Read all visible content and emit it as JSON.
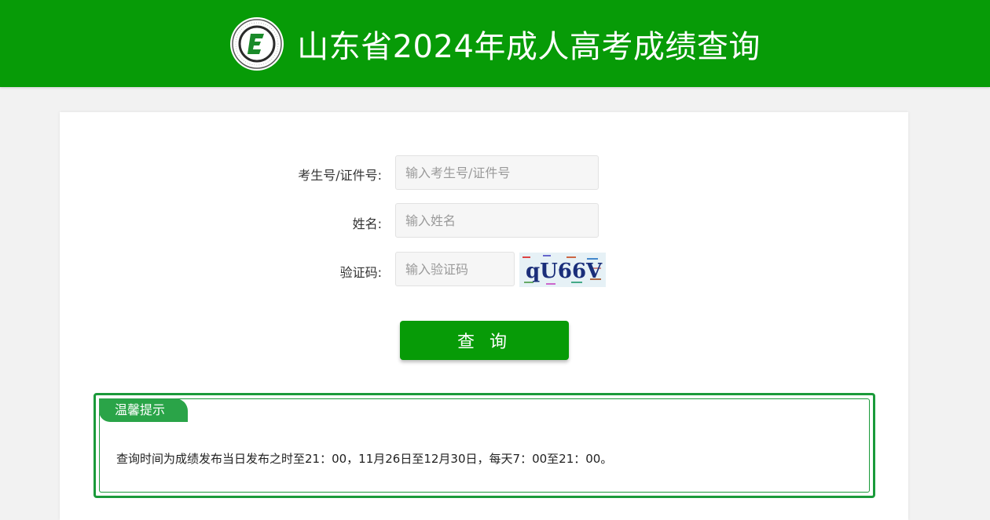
{
  "header": {
    "title": "山东省2024年成人高考成绩查询",
    "logo_icon": "exam-emblem-icon",
    "bg_color": "#079b07"
  },
  "form": {
    "id_label": "考生号/证件号:",
    "id_placeholder": "输入考生号/证件号",
    "name_label": "姓名:",
    "name_placeholder": "输入姓名",
    "captcha_label": "验证码:",
    "captcha_placeholder": "输入验证码",
    "captcha_text": "qU66V",
    "submit_label": "查 询"
  },
  "tip": {
    "title": "温馨提示",
    "text": "查询时间为成绩发布当日发布之时至21：00，11月26日至12月30日，每天7：00至21：00。",
    "accent_color": "#2aa448"
  }
}
